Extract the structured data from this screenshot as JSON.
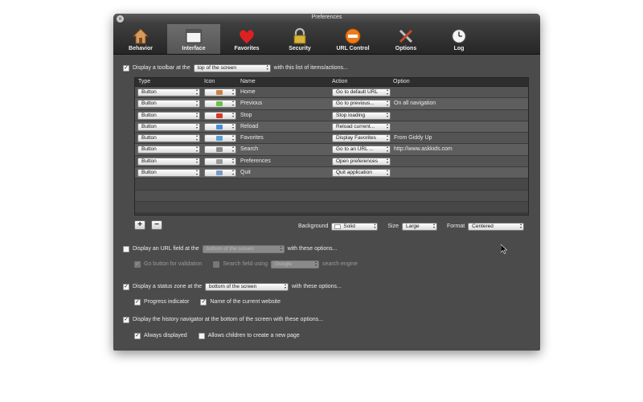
{
  "window": {
    "title": "Preferences"
  },
  "tabs": [
    {
      "label": "Behavior",
      "icon": "house-icon",
      "active": false
    },
    {
      "label": "Interface",
      "icon": "window-icon",
      "active": true
    },
    {
      "label": "Favorites",
      "icon": "heart-icon",
      "active": false
    },
    {
      "label": "Security",
      "icon": "lock-icon",
      "active": false
    },
    {
      "label": "URL Control",
      "icon": "no-entry-icon",
      "active": false
    },
    {
      "label": "Options",
      "icon": "tools-icon",
      "active": false
    },
    {
      "label": "Log",
      "icon": "clock-icon",
      "active": false
    }
  ],
  "toolbar_option": {
    "checked": true,
    "label_before": "Display a toolbar at the",
    "position_value": "top of the screen",
    "label_after": "with this list of items/actions..."
  },
  "table": {
    "headers": {
      "type": "Type",
      "icon": "Icon",
      "name": "Name",
      "action": "Action",
      "option": "Option"
    },
    "rows": [
      {
        "type": "Button",
        "icon": "house-icon",
        "icon_color": "#c8824a",
        "name": "Home",
        "action": "Go to default URL",
        "option": ""
      },
      {
        "type": "Button",
        "icon": "left-arrow-icon",
        "icon_color": "#6cc04a",
        "name": "Previous",
        "action": "Go to previous...",
        "option": "On all navigation"
      },
      {
        "type": "Button",
        "icon": "stop-icon",
        "icon_color": "#d83a2a",
        "name": "Stop",
        "action": "Stop loading",
        "option": ""
      },
      {
        "type": "Button",
        "icon": "reload-icon",
        "icon_color": "#4a8ed8",
        "name": "Reload",
        "action": "Reload current...",
        "option": ""
      },
      {
        "type": "Button",
        "icon": "favorites-icon",
        "icon_color": "#5aa0d0",
        "name": "Favorites",
        "action": "Display Favorites",
        "option": "From Giddy Up"
      },
      {
        "type": "Button",
        "icon": "search-icon",
        "icon_color": "#8a8a8a",
        "name": "Search",
        "action": "Go to an URL ...",
        "option": "http://www.askkids.com"
      },
      {
        "type": "Button",
        "icon": "preferences-icon",
        "icon_color": "#9a9a9a",
        "name": "Preferences",
        "action": "Open preferences",
        "option": ""
      },
      {
        "type": "Button",
        "icon": "quit-icon",
        "icon_color": "#7a9ac8",
        "name": "Quit",
        "action": "Quit application",
        "option": ""
      }
    ],
    "add_label": "+",
    "remove_label": "−"
  },
  "appearance": {
    "background_label": "Background",
    "background_value": "Solid",
    "size_label": "Size",
    "size_value": "Large",
    "format_label": "Format",
    "format_value": "Centered"
  },
  "url_field": {
    "checked": false,
    "label_before": "Display an URL field at the",
    "position_value": "bottom of the screen",
    "label_after": "with these options...",
    "go_button_label": "Go button for validation",
    "search_field_label": "Search field using",
    "search_engine_value": "Google",
    "search_engine_suffix": "search engine"
  },
  "status_zone": {
    "checked": true,
    "label_before": "Display a status zone at the",
    "position_value": "bottom of the screen",
    "label_after": "with these options...",
    "progress_label": "Progress indicator",
    "website_name_label": "Name of the current website"
  },
  "history_nav": {
    "checked": true,
    "label": "Display the history navigator at the bottom of the screen with these options...",
    "always_label": "Always displayed",
    "children_label": "Allows children to create a new page"
  },
  "colors": {
    "window_bg": "#4b4b4b",
    "table_row_odd": "#545454",
    "table_row_even": "#5e5e5e"
  }
}
